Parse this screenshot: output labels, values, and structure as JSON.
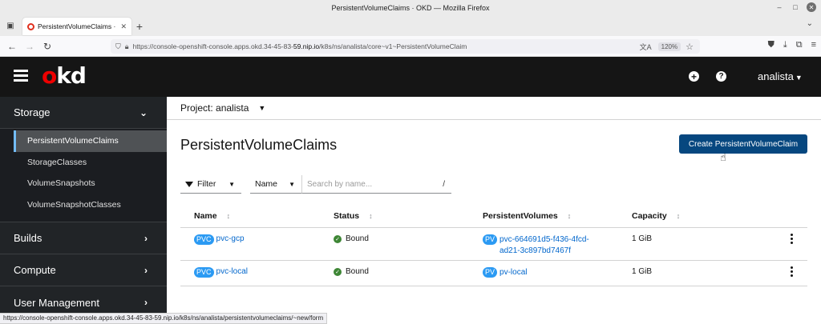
{
  "browser": {
    "window_title": "PersistentVolumeClaims · OKD — Mozilla Firefox",
    "tab_title": "PersistentVolumeClaims · O",
    "url_prefix": "https://console-openshift-console.apps.okd.34-45-83-",
    "url_domain": "59.nip.io",
    "url_suffix": "/k8s/ns/analista/core~v1~PersistentVolumeClaim",
    "zoom": "120%",
    "status_url": "https://console-openshift-console.apps.okd.34-45-83-59.nip.io/k8s/ns/analista/persistentvolumeclaims/~new/form"
  },
  "masthead": {
    "logo_o": "o",
    "logo_rest": "kd",
    "user": "analista"
  },
  "sidebar": {
    "storage": {
      "label": "Storage",
      "items": [
        {
          "label": "PersistentVolumeClaims"
        },
        {
          "label": "StorageClasses"
        },
        {
          "label": "VolumeSnapshots"
        },
        {
          "label": "VolumeSnapshotClasses"
        }
      ]
    },
    "builds": "Builds",
    "compute": "Compute",
    "user_management": "User Management"
  },
  "main": {
    "project_label": "Project: analista",
    "title": "PersistentVolumeClaims",
    "create_button": "Create PersistentVolumeClaim",
    "filter_label": "Filter",
    "name_select": "Name",
    "search_placeholder": "Search by name...",
    "search_shortcut": "/",
    "columns": [
      "Name",
      "Status",
      "PersistentVolumes",
      "Capacity"
    ],
    "rows": [
      {
        "badge": "PVC",
        "name": "pvc-gcp",
        "status": "Bound",
        "pv_badge": "PV",
        "pv_line1": "pvc-664691d5-f436-4fcd-",
        "pv_line2": "ad21-3c897bd7467f",
        "capacity": "1 GiB"
      },
      {
        "badge": "PVC",
        "name": "pvc-local",
        "status": "Bound",
        "pv_badge": "PV",
        "pv_line1": "pv-local",
        "pv_line2": "",
        "capacity": "1 GiB"
      }
    ]
  },
  "colors": {
    "masthead": "#151515",
    "sidebar": "#212427",
    "primary_button": "#06477f",
    "badge": "#2b9af3",
    "bound": "#3e8635",
    "link": "#0066cc"
  }
}
